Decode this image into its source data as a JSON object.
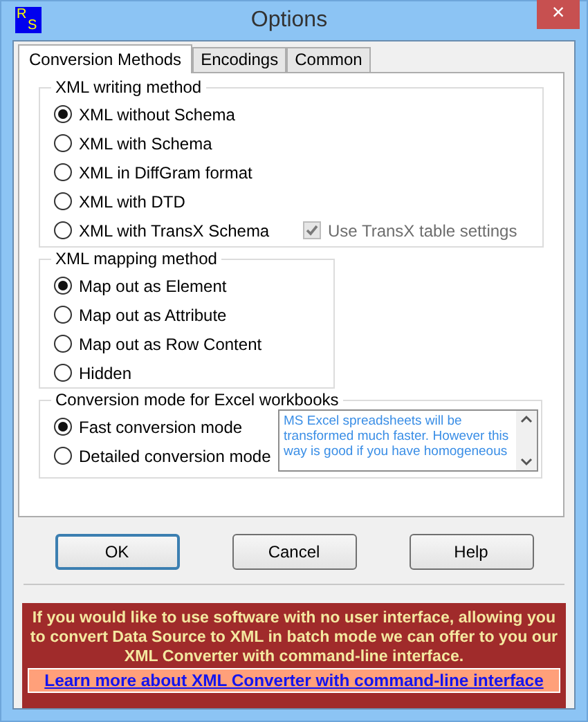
{
  "window": {
    "title": "Options",
    "close": "×",
    "logo": [
      "R",
      "S"
    ]
  },
  "tabs": [
    {
      "label": "Conversion Methods",
      "selected": true
    },
    {
      "label": "Encodings",
      "selected": false
    },
    {
      "label": "Common",
      "selected": false
    }
  ],
  "writing_method": {
    "title": "XML writing method",
    "options": [
      {
        "label": "XML without Schema",
        "selected": true
      },
      {
        "label": "XML with Schema",
        "selected": false
      },
      {
        "label": "XML in DiffGram format",
        "selected": false
      },
      {
        "label": "XML with DTD",
        "selected": false
      },
      {
        "label": "XML with TransX Schema",
        "selected": false
      }
    ],
    "transx_checkbox": {
      "label": "Use TransX table settings",
      "checked": true,
      "disabled": true
    }
  },
  "mapping_method": {
    "title": "XML mapping method",
    "options": [
      {
        "label": "Map out as Element",
        "selected": true
      },
      {
        "label": "Map out as Attribute",
        "selected": false
      },
      {
        "label": "Map out as Row Content",
        "selected": false
      },
      {
        "label": "Hidden",
        "selected": false
      }
    ]
  },
  "excel_mode": {
    "title": "Conversion mode for Excel workbooks",
    "options": [
      {
        "label": "Fast conversion mode",
        "selected": true
      },
      {
        "label": "Detailed conversion mode",
        "selected": false
      }
    ],
    "description_lines": [
      "MS Excel spreadsheets will be",
      "transformed much faster. However this",
      "way is good if you have homogeneous"
    ]
  },
  "buttons": [
    {
      "label": "OK",
      "default": true
    },
    {
      "label": "Cancel",
      "default": false
    },
    {
      "label": "Help",
      "default": false
    }
  ],
  "banner": {
    "text": "If you would like to use software with no user interface, allowing you to convert Data Source to XML in batch mode we can offer to you our XML Converter with command-line interface.",
    "link": "Learn more about XML Converter with command-line interface"
  }
}
